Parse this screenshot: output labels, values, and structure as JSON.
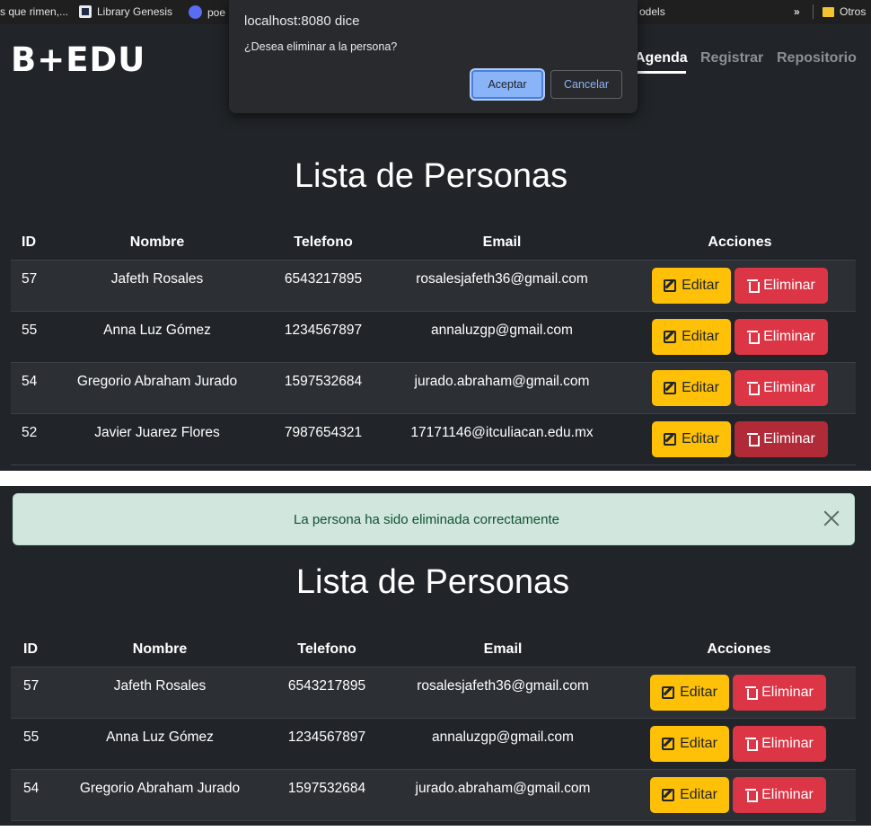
{
  "bookmarks": {
    "items": [
      {
        "label": "s que rimen,..."
      },
      {
        "label": "Library Genesis"
      },
      {
        "label": "poe"
      },
      {
        "label": "odels"
      },
      {
        "label": "»"
      },
      {
        "label": "Otros"
      }
    ]
  },
  "navbar": {
    "logo": "B+EDU",
    "links": [
      "Agenda",
      "Registrar",
      "Repositorio"
    ],
    "active": "Agenda"
  },
  "dialog": {
    "title": "localhost:8080 dice",
    "message": "¿Desea eliminar a la persona?",
    "ok_label": "Aceptar",
    "cancel_label": "Cancelar"
  },
  "page": {
    "title": "Lista de Personas",
    "columns": [
      "ID",
      "Nombre",
      "Telefono",
      "Email",
      "Acciones"
    ],
    "edit_label": "Editar",
    "delete_label": "Eliminar"
  },
  "before_rows": [
    {
      "id": "57",
      "nombre": "Jafeth Rosales",
      "telefono": "6543217895",
      "email": "rosalesjafeth36@gmail.com"
    },
    {
      "id": "55",
      "nombre": "Anna Luz Gómez",
      "telefono": "1234567897",
      "email": "annaluzgp@gmail.com"
    },
    {
      "id": "54",
      "nombre": "Gregorio Abraham Jurado",
      "telefono": "1597532684",
      "email": "jurado.abraham@gmail.com"
    },
    {
      "id": "52",
      "nombre": "Javier Juarez Flores",
      "telefono": "7987654321",
      "email": "17171146@itculiacan.edu.mx"
    }
  ],
  "alert": {
    "message": "La persona ha sido eliminada correctamente"
  },
  "after_rows": [
    {
      "id": "57",
      "nombre": "Jafeth Rosales",
      "telefono": "6543217895",
      "email": "rosalesjafeth36@gmail.com"
    },
    {
      "id": "55",
      "nombre": "Anna Luz Gómez",
      "telefono": "1234567897",
      "email": "annaluzgp@gmail.com"
    },
    {
      "id": "54",
      "nombre": "Gregorio Abraham Jurado",
      "telefono": "1597532684",
      "email": "jurado.abraham@gmail.com"
    }
  ],
  "colors": {
    "background": "#212529",
    "edit_button": "#ffc107",
    "delete_button": "#dc3545",
    "alert_bg": "#d1e7dd",
    "dialog_primary": "#8ab4f8"
  }
}
